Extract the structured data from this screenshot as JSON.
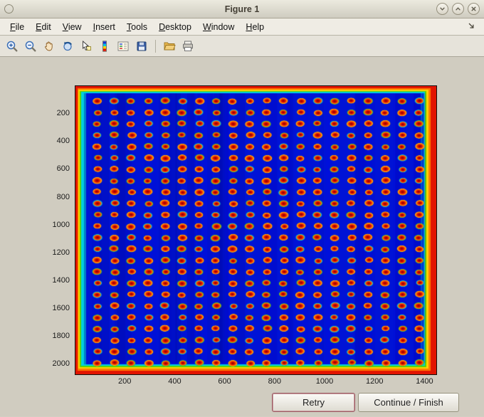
{
  "window": {
    "title": "Figure 1"
  },
  "menubar": {
    "items": [
      "File",
      "Edit",
      "View",
      "Insert",
      "Tools",
      "Desktop",
      "Window",
      "Help"
    ]
  },
  "icons": {
    "window_controls": [
      "minimize",
      "maximize",
      "close"
    ],
    "toolbar": [
      "zoom-in",
      "zoom-out",
      "pan",
      "rotate-3d",
      "data-cursor",
      "colorbar",
      "insert-legend",
      "save",
      "open-folder",
      "print"
    ],
    "menubar_right": "dock-figure"
  },
  "buttons": {
    "retry_label": "Retry",
    "continue_label": "Continue / Finish"
  },
  "chart_data": {
    "type": "heatmap",
    "title": "",
    "xlabel": "",
    "ylabel": "",
    "colormap": "jet",
    "description": "Microarray / plate scan image: regular grid of red-orange spots with yellow-green halos on a deep blue background; image borders glow red-orange-yellow (hot edges), jet colormap.",
    "x_range": [
      0,
      1450
    ],
    "y_range": [
      0,
      2080
    ],
    "x_ticks": [
      200,
      400,
      600,
      800,
      1000,
      1200,
      1400
    ],
    "y_ticks": [
      200,
      400,
      600,
      800,
      1000,
      1200,
      1400,
      1600,
      1800,
      2000
    ],
    "grid": {
      "rows": 24,
      "cols": 20
    },
    "colors": {
      "background": "#0013d6",
      "spot_center": "#8f0000",
      "spot_mid": "#e31400",
      "spot_ring": "#ff6a00",
      "edge_hot": "#e11400",
      "edge_orange": "#ff7a00",
      "edge_yellow": "#ffd300",
      "edge_green": "#58d400",
      "edge_cyan": "#00cfe0"
    }
  }
}
